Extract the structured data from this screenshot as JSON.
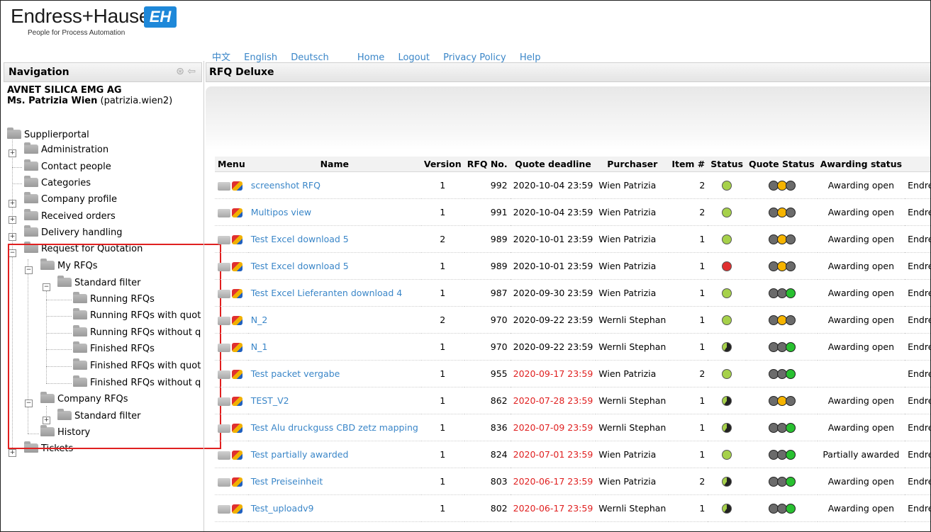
{
  "header": {
    "brand": "Endress+Hauser",
    "brand_mark": "EH",
    "tagline": "People for Process Automation",
    "nav_links": [
      "中文",
      "English",
      "Deutsch",
      "Home",
      "Logout",
      "Privacy Policy",
      "Help"
    ]
  },
  "navigation": {
    "title": "Navigation",
    "company": "AVNET SILICA EMG AG",
    "user_name": "Ms. Patrizia Wien",
    "user_login": "(patrizia.wien2)",
    "root": "Supplierportal",
    "items": {
      "administration": "Administration",
      "contact_people": "Contact people",
      "categories": "Categories",
      "company_profile": "Company profile",
      "received_orders": "Received orders",
      "delivery_handling": "Delivery handling",
      "rfq": "Request for Quotation",
      "my_rfqs": "My RFQs",
      "standard_filter": "Standard filter",
      "running_rfqs": "Running RFQs",
      "running_with_quote": "Running RFQs with quot",
      "running_without_quote": "Running RFQs without q",
      "finished_rfqs": "Finished RFQs",
      "finished_with_quote": "Finished RFQs with quot",
      "finished_without_quote": "Finished RFQs without q",
      "company_rfqs": "Company RFQs",
      "company_standard_filter": "Standard filter",
      "history": "History",
      "tickets": "Tickets"
    }
  },
  "main": {
    "title": "RFQ Deluxe",
    "columns": [
      "Menu",
      "Name",
      "Version",
      "RFQ No.",
      "Quote deadline",
      "Purchaser",
      "Item #",
      "Status",
      "Quote Status",
      "Awarding status",
      ""
    ],
    "rows": [
      {
        "name": "screenshot RFQ",
        "version": "1",
        "rfq_no": "992",
        "deadline": "2020-10-04 23:59",
        "late": false,
        "purchaser": "Wien Patrizia",
        "items": "2",
        "status": "green",
        "quote_status": "yellow",
        "awarding": "Awarding open",
        "buyer": "Endress+Hauser"
      },
      {
        "name": "Multipos view",
        "version": "1",
        "rfq_no": "991",
        "deadline": "2020-10-04 23:59",
        "late": false,
        "purchaser": "Wien Patrizia",
        "items": "2",
        "status": "green",
        "quote_status": "yellow",
        "awarding": "Awarding open",
        "buyer": "Endress+Hauser"
      },
      {
        "name": "Test Excel download 5",
        "version": "2",
        "rfq_no": "989",
        "deadline": "2020-10-01 23:59",
        "late": false,
        "purchaser": "Wien Patrizia",
        "items": "1",
        "status": "green",
        "quote_status": "yellow",
        "awarding": "Awarding open",
        "buyer": "Endress+Hauser"
      },
      {
        "name": "Test Excel download 5",
        "version": "1",
        "rfq_no": "989",
        "deadline": "2020-10-01 23:59",
        "late": false,
        "purchaser": "Wien Patrizia",
        "items": "1",
        "status": "red",
        "quote_status": "yellow",
        "awarding": "Awarding open",
        "buyer": "Endress+Hauser"
      },
      {
        "name": "Test Excel Lieferanten download 4",
        "version": "1",
        "rfq_no": "987",
        "deadline": "2020-09-30 23:59",
        "late": false,
        "purchaser": "Wien Patrizia",
        "items": "1",
        "status": "green",
        "quote_status": "green",
        "awarding": "Awarding open",
        "buyer": "Endress+Hauser"
      },
      {
        "name": "N_2",
        "version": "2",
        "rfq_no": "970",
        "deadline": "2020-09-22 23:59",
        "late": false,
        "purchaser": "Wernli Stephan",
        "items": "1",
        "status": "green",
        "quote_status": "yellow",
        "awarding": "Awarding open",
        "buyer": "Endress+Hauser"
      },
      {
        "name": "N_1",
        "version": "1",
        "rfq_no": "970",
        "deadline": "2020-09-22 23:59",
        "late": false,
        "purchaser": "Wernli Stephan",
        "items": "1",
        "status": "half",
        "quote_status": "green",
        "awarding": "Awarding open",
        "buyer": "Endress+Hauser"
      },
      {
        "name": "Test packet vergabe",
        "version": "1",
        "rfq_no": "955",
        "deadline": "2020-09-17 23:59",
        "late": true,
        "purchaser": "Wien Patrizia",
        "items": "2",
        "status": "check",
        "quote_status": "green",
        "awarding": "",
        "buyer": "Endress+Hauser"
      },
      {
        "name": "TEST_V2",
        "version": "1",
        "rfq_no": "862",
        "deadline": "2020-07-28 23:59",
        "late": true,
        "purchaser": "Wernli Stephan",
        "items": "1",
        "status": "half",
        "quote_status": "yellow",
        "awarding": "Awarding open",
        "buyer": "Endress+Hauser"
      },
      {
        "name": "Test Alu druckguss CBD zetz mapping",
        "version": "1",
        "rfq_no": "836",
        "deadline": "2020-07-09 23:59",
        "late": true,
        "purchaser": "Wernli Stephan",
        "items": "1",
        "status": "half",
        "quote_status": "green",
        "awarding": "Awarding open",
        "buyer": "Endress+Hauser"
      },
      {
        "name": "Test partially awarded",
        "version": "1",
        "rfq_no": "824",
        "deadline": "2020-07-01 23:59",
        "late": true,
        "purchaser": "Wien Patrizia",
        "items": "1",
        "status": "check",
        "quote_status": "green",
        "awarding": "Partially awarded",
        "buyer": "Endress+Hauser"
      },
      {
        "name": "Test Preiseinheit",
        "version": "1",
        "rfq_no": "803",
        "deadline": "2020-06-17 23:59",
        "late": true,
        "purchaser": "Wien Patrizia",
        "items": "2",
        "status": "half",
        "quote_status": "green",
        "awarding": "Awarding open",
        "buyer": "Endress+Hauser"
      },
      {
        "name": "Test_uploadv9",
        "version": "1",
        "rfq_no": "802",
        "deadline": "2020-06-17 23:59",
        "late": true,
        "purchaser": "Wernli Stephan",
        "items": "1",
        "status": "half",
        "quote_status": "green",
        "awarding": "Awarding open",
        "buyer": "Endress+Hauser"
      }
    ]
  },
  "colors": {
    "link": "#3a86c8",
    "late": "#e02020",
    "highlight": "#e02020",
    "brand": "#1e88d9"
  }
}
